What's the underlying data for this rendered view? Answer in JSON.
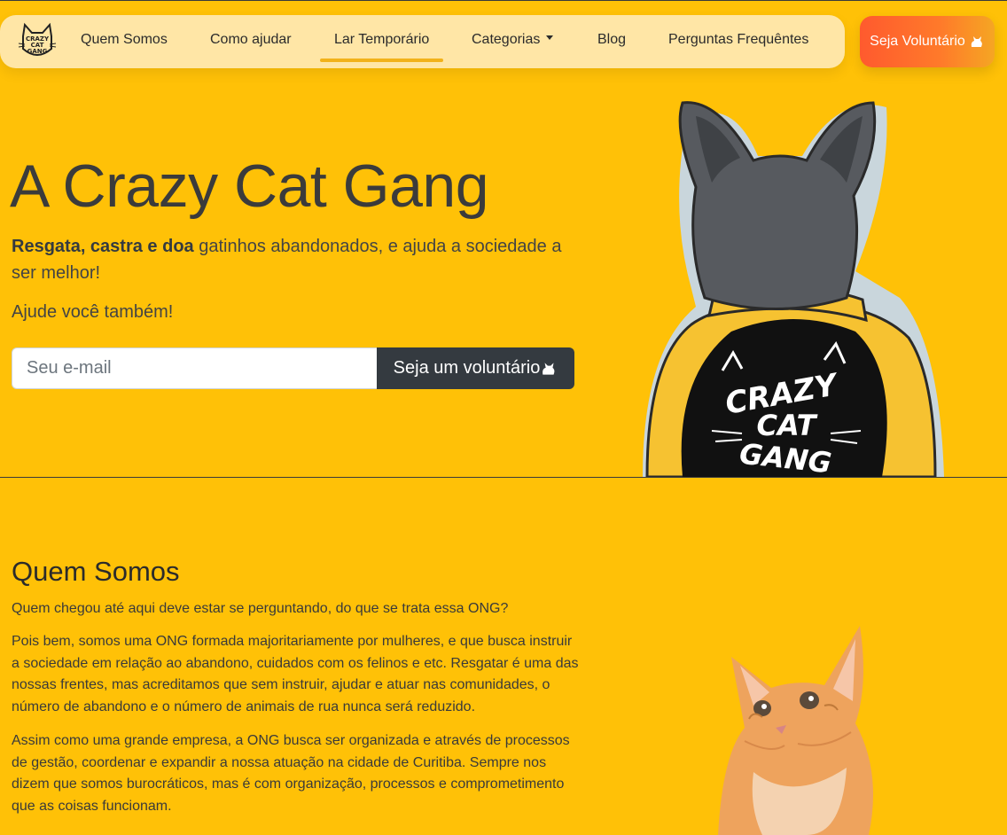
{
  "nav": {
    "items": [
      "Quem Somos",
      "Como ajudar",
      "Lar Temporário",
      "Categorias",
      "Blog",
      "Perguntas Frequêntes"
    ],
    "active": "Lar Temporário",
    "logo_text": [
      "CRAZY",
      "CAT",
      "GANG"
    ],
    "cta_label": "Seja Voluntário"
  },
  "hero": {
    "title": "A Crazy Cat Gang",
    "subtitle_bold": "Resgata, castra e doa",
    "subtitle_rest": " gatinhos abandonados, e ajuda a sociedade a ser melhor!",
    "help_text": "Ajude você também!",
    "email_placeholder": "Seu e-mail",
    "button_label": "Seja um voluntário",
    "jacket_text": [
      "CRAZY",
      "CAT",
      "GANG"
    ]
  },
  "about": {
    "title": "Quem Somos",
    "paragraphs": [
      "Quem chegou até aqui deve estar se perguntando, do que se trata essa ONG?",
      "Pois bem, somos uma ONG formada majoritariamente por mulheres, e que busca instruir a sociedade em relação ao abandono, cuidados com os felinos e etc. Resgatar é uma das nossas frentes, mas acreditamos que sem instruir, ajudar e atuar nas comunidades, o número de abandono e o número de animais de rua nunca será reduzido.",
      "Assim como uma grande empresa, a ONG busca ser organizada e através de processos de gestão, coordenar e expandir a nossa atuação na cidade de Curitiba. Sempre nos dizem que somos burocráticos, mas é com organização, processos e comprometimento que as coisas funcionam."
    ]
  },
  "colors": {
    "background": "#ffc107",
    "navbar": "#ffe6a6",
    "dark_button": "#343a40",
    "cta_gradient_start": "#ff5a2e",
    "cta_gradient_end": "#f5a623"
  },
  "icons": [
    "cat-logo-icon",
    "caret-down-icon",
    "cat-icon"
  ]
}
